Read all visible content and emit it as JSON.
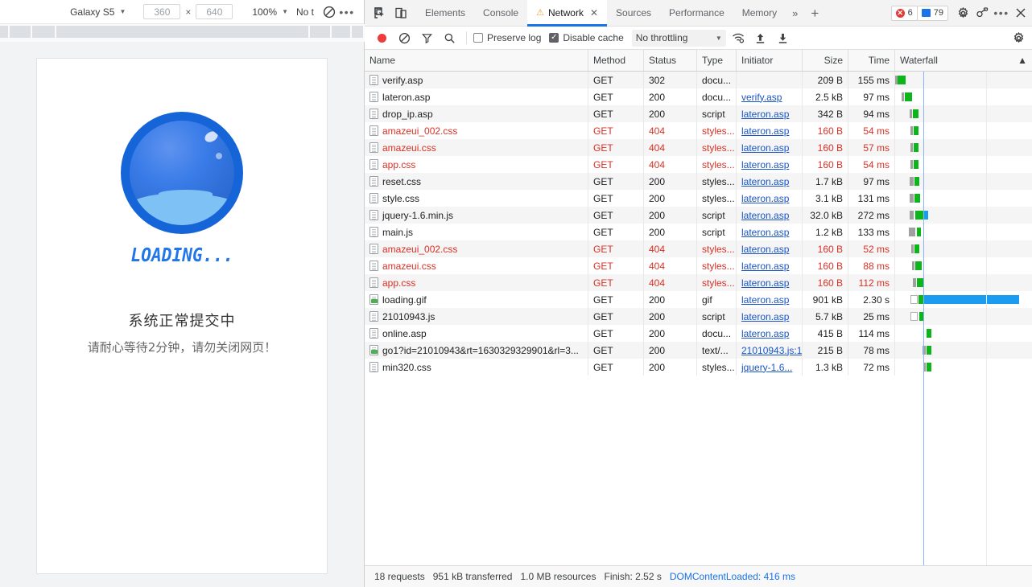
{
  "device_toolbar": {
    "device_name": "Galaxy S5",
    "width": "360",
    "height": "640",
    "zoom": "100%",
    "throttling": "No t",
    "throttling_icon": "no-throttling-icon",
    "more_icon": "more-options-icon"
  },
  "page": {
    "loading_label": "LOADING...",
    "message_main": "系统正常提交中",
    "message_sub": "请耐心等待2分钟，请勿关闭网页！",
    "sphere_color": "#1565d8",
    "liquid_color": "#7ec1f5",
    "loading_text_color": "#2176e8"
  },
  "devtools": {
    "tabs": [
      {
        "label": "Elements",
        "active": false,
        "warn": false,
        "closable": false
      },
      {
        "label": "Console",
        "active": false,
        "warn": false,
        "closable": false
      },
      {
        "label": "Network",
        "active": true,
        "warn": true,
        "closable": true
      },
      {
        "label": "Sources",
        "active": false,
        "warn": false,
        "closable": false
      },
      {
        "label": "Performance",
        "active": false,
        "warn": false,
        "closable": false
      },
      {
        "label": "Memory",
        "active": false,
        "warn": false,
        "closable": false
      }
    ],
    "more_tabs_icon": "chevron-double-right-icon",
    "add_tab_icon": "plus-icon",
    "error_count": "6",
    "message_count": "79",
    "settings_icon": "gear-icon",
    "devices_icon": "devices-icon",
    "menu_icon": "more-vertical-icon",
    "close_icon": "close-icon",
    "inspect_icon": "inspect-element-icon",
    "device_toggle_icon": "toggle-device-toolbar-icon"
  },
  "network_toolbar": {
    "record_icon": "record-button",
    "clear_icon": "clear-icon",
    "filter_icon": "filter-icon",
    "search_icon": "search-icon",
    "preserve_log_label": "Preserve log",
    "preserve_log_checked": false,
    "disable_cache_label": "Disable cache",
    "disable_cache_checked": true,
    "throttling_value": "No throttling",
    "wifi_icon": "network-conditions-icon",
    "upload_icon": "import-har-icon",
    "download_icon": "export-har-icon",
    "settings_icon": "gear-icon"
  },
  "table": {
    "columns": [
      {
        "key": "name",
        "label": "Name"
      },
      {
        "key": "method",
        "label": "Method"
      },
      {
        "key": "status",
        "label": "Status"
      },
      {
        "key": "type",
        "label": "Type"
      },
      {
        "key": "initiator",
        "label": "Initiator"
      },
      {
        "key": "size",
        "label": "Size"
      },
      {
        "key": "time",
        "label": "Time"
      },
      {
        "key": "waterfall",
        "label": "Waterfall"
      }
    ],
    "sort_indicator": "▲",
    "rows": [
      {
        "name": "verify.asp",
        "icon": "document-icon",
        "method": "GET",
        "status": "302",
        "type": "docu...",
        "initiator": "",
        "size": "209 B",
        "time": "155 ms",
        "error": false,
        "wf": {
          "gray": [
            0,
            3
          ],
          "green": [
            3,
            10
          ],
          "blue": null
        }
      },
      {
        "name": "lateron.asp",
        "icon": "document-icon",
        "method": "GET",
        "status": "200",
        "type": "docu...",
        "initiator": "verify.asp",
        "size": "2.5 kB",
        "time": "97 ms",
        "error": false,
        "wf": {
          "gray": [
            8,
            3
          ],
          "green": [
            12,
            9
          ],
          "blue": null
        }
      },
      {
        "name": "drop_ip.asp",
        "icon": "document-icon",
        "method": "GET",
        "status": "200",
        "type": "script",
        "initiator": "lateron.asp",
        "size": "342 B",
        "time": "94 ms",
        "error": false,
        "wf": {
          "gray": [
            18,
            3
          ],
          "green": [
            22,
            7
          ],
          "blue": null
        }
      },
      {
        "name": "amazeui_002.css",
        "icon": "document-icon",
        "method": "GET",
        "status": "404",
        "type": "styles...",
        "initiator": "lateron.asp",
        "size": "160 B",
        "time": "54 ms",
        "error": true,
        "wf": {
          "gray": [
            19,
            3
          ],
          "green": [
            23,
            6
          ],
          "blue": null
        }
      },
      {
        "name": "amazeui.css",
        "icon": "document-icon",
        "method": "GET",
        "status": "404",
        "type": "styles...",
        "initiator": "lateron.asp",
        "size": "160 B",
        "time": "57 ms",
        "error": true,
        "wf": {
          "gray": [
            19,
            3
          ],
          "green": [
            23,
            6
          ],
          "blue": null
        }
      },
      {
        "name": "app.css",
        "icon": "document-icon",
        "method": "GET",
        "status": "404",
        "type": "styles...",
        "initiator": "lateron.asp",
        "size": "160 B",
        "time": "54 ms",
        "error": true,
        "wf": {
          "gray": [
            19,
            3
          ],
          "green": [
            23,
            6
          ],
          "blue": null
        }
      },
      {
        "name": "reset.css",
        "icon": "document-icon",
        "method": "GET",
        "status": "200",
        "type": "styles...",
        "initiator": "lateron.asp",
        "size": "1.7 kB",
        "time": "97 ms",
        "error": false,
        "wf": {
          "gray": [
            18,
            5
          ],
          "green": [
            24,
            6
          ],
          "blue": null
        }
      },
      {
        "name": "style.css",
        "icon": "document-icon",
        "method": "GET",
        "status": "200",
        "type": "styles...",
        "initiator": "lateron.asp",
        "size": "3.1 kB",
        "time": "131 ms",
        "error": false,
        "wf": {
          "gray": [
            18,
            5
          ],
          "green": [
            24,
            7
          ],
          "blue": null
        }
      },
      {
        "name": "jquery-1.6.min.js",
        "icon": "document-icon",
        "method": "GET",
        "status": "200",
        "type": "script",
        "initiator": "lateron.asp",
        "size": "32.0 kB",
        "time": "272 ms",
        "error": false,
        "wf": {
          "gray": [
            18,
            5
          ],
          "green": [
            25,
            10
          ],
          "blue": [
            35,
            6
          ]
        }
      },
      {
        "name": "main.js",
        "icon": "document-icon",
        "method": "GET",
        "status": "200",
        "type": "script",
        "initiator": "lateron.asp",
        "size": "1.2 kB",
        "time": "133 ms",
        "error": false,
        "wf": {
          "gray": [
            17,
            8
          ],
          "green": [
            27,
            5
          ],
          "blue": null
        }
      },
      {
        "name": "amazeui_002.css",
        "icon": "document-icon",
        "method": "GET",
        "status": "404",
        "type": "styles...",
        "initiator": "lateron.asp",
        "size": "160 B",
        "time": "52 ms",
        "error": true,
        "wf": {
          "gray": [
            20,
            3
          ],
          "green": [
            24,
            6
          ],
          "blue": null
        }
      },
      {
        "name": "amazeui.css",
        "icon": "document-icon",
        "method": "GET",
        "status": "404",
        "type": "styles...",
        "initiator": "lateron.asp",
        "size": "160 B",
        "time": "88 ms",
        "error": true,
        "wf": {
          "gray": [
            21,
            3
          ],
          "green": [
            25,
            8
          ],
          "blue": null
        }
      },
      {
        "name": "app.css",
        "icon": "document-icon",
        "method": "GET",
        "status": "404",
        "type": "styles...",
        "initiator": "lateron.asp",
        "size": "160 B",
        "time": "112 ms",
        "error": true,
        "wf": {
          "gray": [
            22,
            4
          ],
          "green": [
            27,
            8
          ],
          "blue": null
        }
      },
      {
        "name": "loading.gif",
        "icon": "image-icon",
        "method": "GET",
        "status": "200",
        "type": "gif",
        "initiator": "lateron.asp",
        "size": "901 kB",
        "time": "2.30 s",
        "error": false,
        "wf": {
          "open": [
            19,
            9
          ],
          "green": [
            29,
            6
          ],
          "blue": [
            36,
            118
          ]
        }
      },
      {
        "name": "21010943.js",
        "icon": "document-icon",
        "method": "GET",
        "status": "200",
        "type": "script",
        "initiator": "lateron.asp",
        "size": "5.7 kB",
        "time": "25 ms",
        "error": false,
        "wf": {
          "open": [
            19,
            9
          ],
          "green": [
            30,
            5
          ],
          "blue": null
        }
      },
      {
        "name": "online.asp",
        "icon": "document-icon",
        "method": "GET",
        "status": "200",
        "type": "docu...",
        "initiator": "lateron.asp",
        "size": "415 B",
        "time": "114 ms",
        "error": false,
        "wf": {
          "gray": null,
          "green": [
            39,
            6
          ],
          "blue": null
        }
      },
      {
        "name": "go1?id=21010943&rt=1630329329901&rl=3...",
        "icon": "image-icon",
        "method": "GET",
        "status": "200",
        "type": "text/...",
        "initiator": "21010943.js:1",
        "size": "215 B",
        "time": "78 ms",
        "error": false,
        "wf": {
          "gray": [
            34,
            4
          ],
          "green": [
            39,
            6
          ],
          "blue": null
        }
      },
      {
        "name": "min320.css",
        "icon": "document-icon",
        "method": "GET",
        "status": "200",
        "type": "styles...",
        "initiator": "jquery-1.6...",
        "size": "1.3 kB",
        "time": "72 ms",
        "error": false,
        "wf": {
          "gray": [
            35,
            3
          ],
          "green": [
            39,
            6
          ],
          "blue": null
        }
      }
    ]
  },
  "footer": {
    "requests": "18 requests",
    "transferred": "951 kB transferred",
    "resources": "1.0 MB resources",
    "finish": "Finish: 2.52 s",
    "dom_content_loaded": "DOMContentLoaded: 416 ms"
  }
}
